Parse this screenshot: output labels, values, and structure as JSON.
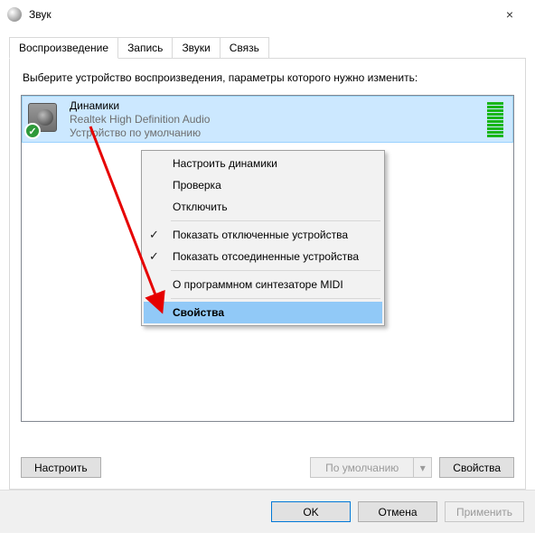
{
  "window": {
    "title": "Звук",
    "close_label": "×"
  },
  "tabs": [
    {
      "label": "Воспроизведение",
      "active": true
    },
    {
      "label": "Запись",
      "active": false
    },
    {
      "label": "Звуки",
      "active": false
    },
    {
      "label": "Связь",
      "active": false
    }
  ],
  "instruction": "Выберите устройство воспроизведения, параметры которого нужно изменить:",
  "device": {
    "name": "Динамики",
    "driver": "Realtek High Definition Audio",
    "status": "Устройство по умолчанию"
  },
  "panel_buttons": {
    "configure": "Настроить",
    "set_default": "По умолчанию",
    "properties": "Свойства"
  },
  "footer": {
    "ok": "OK",
    "cancel": "Отмена",
    "apply": "Применить"
  },
  "context_menu": {
    "items": [
      {
        "label": "Настроить динамики",
        "checked": false
      },
      {
        "label": "Проверка",
        "checked": false
      },
      {
        "label": "Отключить",
        "checked": false
      },
      {
        "sep": true
      },
      {
        "label": "Показать отключенные устройства",
        "checked": true
      },
      {
        "label": "Показать отсоединенные устройства",
        "checked": true
      },
      {
        "sep": true
      },
      {
        "label": "О программном синтезаторе MIDI",
        "checked": false
      },
      {
        "sep": true
      },
      {
        "label": "Свойства",
        "checked": false,
        "hover": true
      }
    ]
  }
}
